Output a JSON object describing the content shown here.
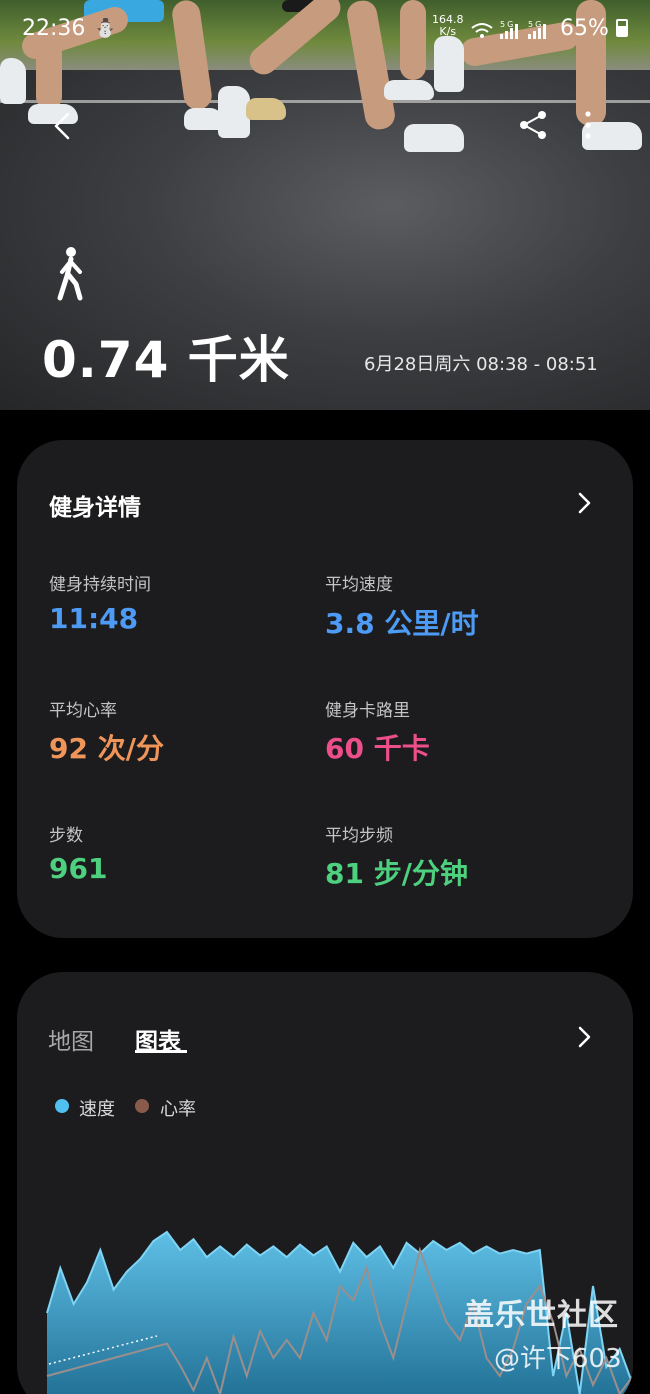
{
  "status_bar": {
    "time": "22:36",
    "net_rate_value": "164.8",
    "net_rate_unit": "K/s",
    "signal_icons": "wifi 5G 5G",
    "battery": "65%"
  },
  "hero": {
    "distance": "0.74 千米",
    "datetime": "6月28日周六 08:38 - 08:51",
    "icons": [
      "back-arrow-icon",
      "share-icon",
      "more-vertical-icon",
      "walking-person-icon"
    ]
  },
  "details": {
    "title": "健身详情",
    "stats": [
      {
        "label": "健身持续时间",
        "value": "11:48",
        "color": "#4d9bf5"
      },
      {
        "label": "平均速度",
        "value": "3.8 公里/时",
        "color": "#4d9bf5"
      },
      {
        "label": "平均心率",
        "value": "92 次/分",
        "color": "#f0955a"
      },
      {
        "label": "健身卡路里",
        "value": "60 千卡",
        "color": "#ec4f8a"
      },
      {
        "label": "步数",
        "value": "961",
        "color": "#4dd17f"
      },
      {
        "label": "平均步频",
        "value": "81 步/分钟",
        "color": "#4dd17f"
      }
    ]
  },
  "chart_card": {
    "tabs": [
      {
        "label": "地图",
        "active": false
      },
      {
        "label": "图表",
        "active": true
      }
    ],
    "legend": [
      {
        "label": "速度",
        "color": "#4fc0ef"
      },
      {
        "label": "心率",
        "color": "#8a5a4a"
      }
    ]
  },
  "chart_data": {
    "type": "area",
    "series": [
      {
        "name": "速度",
        "values": [
          0.55,
          0.8,
          0.6,
          0.72,
          0.9,
          0.68,
          0.78,
          0.85,
          0.95,
          1.0,
          0.9,
          0.96,
          0.86,
          0.92,
          0.86,
          0.93,
          0.87,
          0.92,
          0.86,
          0.93,
          0.87,
          0.92,
          0.78,
          0.94,
          0.86,
          0.92,
          0.8,
          0.94,
          0.88,
          0.95,
          0.9,
          0.94,
          0.88,
          0.92,
          0.88,
          0.9,
          0.88,
          0.9,
          0.2,
          0.55,
          0.1,
          0.7,
          0.25,
          0.35,
          0.15
        ]
      },
      {
        "name": "心率",
        "values": [
          0.2,
          0.22,
          0.24,
          0.26,
          0.28,
          0.3,
          0.32,
          0.34,
          0.36,
          0.38,
          0.26,
          0.12,
          0.3,
          0.1,
          0.42,
          0.2,
          0.45,
          0.3,
          0.4,
          0.3,
          0.55,
          0.4,
          0.7,
          0.62,
          0.8,
          0.5,
          0.3,
          0.6,
          0.9,
          0.7,
          0.5,
          0.4,
          0.6,
          0.3,
          0.2,
          0.35,
          0.6,
          0.7,
          0.5,
          0.2,
          0.35,
          0.15,
          0.3,
          0.1,
          0.2
        ]
      }
    ]
  },
  "watermark": {
    "line1": "盖乐世社区",
    "line2": "@许下603"
  }
}
